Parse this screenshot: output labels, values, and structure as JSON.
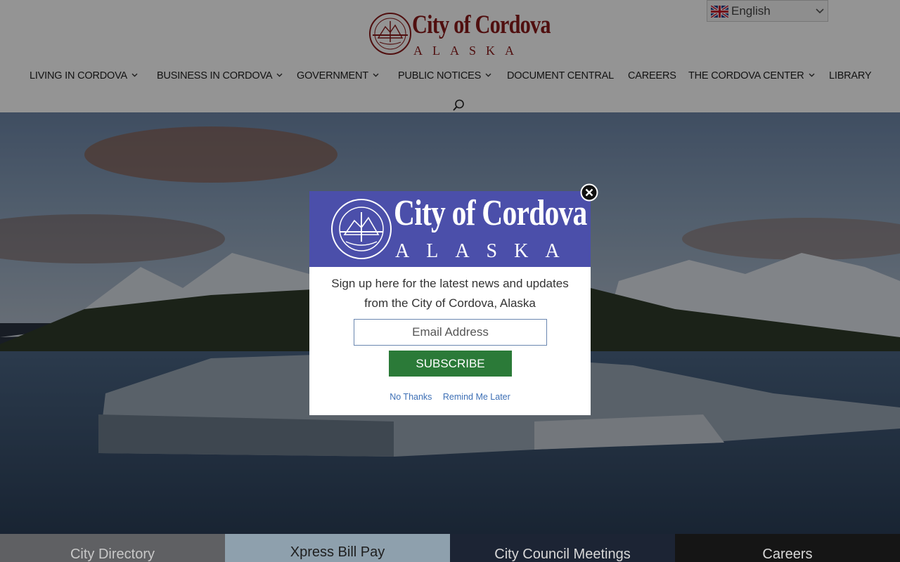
{
  "header": {
    "logo": {
      "title": "City of Cordova",
      "subtitle": "ALASKA",
      "seal_icon": "city-seal-icon"
    },
    "language": {
      "flag_icon": "uk-flag-icon",
      "label": "English",
      "caret_icon": "chevron-down-icon"
    },
    "nav": [
      {
        "label": "LIVING IN CORDOVA",
        "has_dropdown": true
      },
      {
        "label": "BUSINESS IN CORDOVA",
        "has_dropdown": true
      },
      {
        "label": "GOVERNMENT",
        "has_dropdown": true
      },
      {
        "label": "PUBLIC NOTICES",
        "has_dropdown": true
      },
      {
        "label": "DOCUMENT CENTRAL",
        "has_dropdown": false
      },
      {
        "label": "CAREERS",
        "has_dropdown": false
      },
      {
        "label": "THE CORDOVA CENTER",
        "has_dropdown": true
      },
      {
        "label": "LIBRARY",
        "has_dropdown": false
      }
    ],
    "search_icon": "search-icon"
  },
  "popup": {
    "banner_title": "City of Cordova",
    "banner_subtitle": "ALASKA",
    "message": "Sign up here for the latest news and updates from the City of Cordova, Alaska",
    "email_placeholder": "Email Address",
    "subscribe_label": "SUBSCRIBE",
    "no_thanks": "No Thanks",
    "remind_later": "Remind Me Later",
    "close_icon": "close-icon"
  },
  "tiles": [
    {
      "label": "City Directory"
    },
    {
      "label": "Xpress Bill Pay"
    },
    {
      "label": "City Council Meetings"
    },
    {
      "label": "Careers"
    }
  ],
  "colors": {
    "brand_red": "#8b1a1a",
    "popup_banner": "#4b4faa",
    "subscribe_green": "#2b7a38",
    "link_blue": "#3d6fb5"
  }
}
